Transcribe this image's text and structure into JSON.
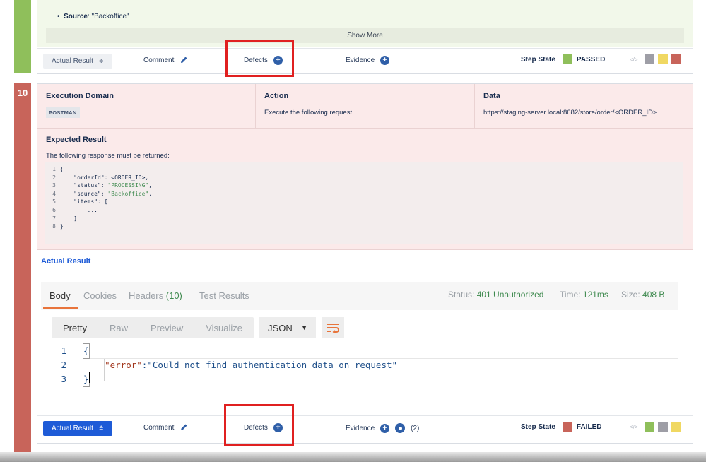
{
  "step9": {
    "source_label": "Source",
    "source_value": ": \"Backoffice\"",
    "show_more": "Show More",
    "toolbar": {
      "actual_result": "Actual Result",
      "actual_result_chevron": "≡",
      "comment": "Comment",
      "defects": "Defects",
      "evidence": "Evidence",
      "step_state_label": "Step State",
      "step_state_value": "PASSED",
      "state_color": "#8fbf5b",
      "status_squares": [
        "#9e9ea6",
        "#f0d862",
        "#c8645a"
      ]
    }
  },
  "step10": {
    "number": "10",
    "columns": {
      "execution_domain_header": "Execution Domain",
      "execution_domain_value": "POSTMAN",
      "action_header": "Action",
      "action_value": "Execute the following request.",
      "data_header": "Data",
      "data_value": "https://staging-server.local:8682/store/order/<ORDER_ID>"
    },
    "expected_result": {
      "title": "Expected Result",
      "description": "The following response must be returned:",
      "code_lines": [
        {
          "n": "1",
          "text": "{"
        },
        {
          "n": "2",
          "text": "    \"orderId\": <ORDER_ID>,"
        },
        {
          "n": "3",
          "key": "    \"status\": ",
          "str": "\"PROCESSING\"",
          "end": ","
        },
        {
          "n": "4",
          "key": "    \"source\": ",
          "str": "\"Backoffice\"",
          "end": ","
        },
        {
          "n": "5",
          "text": "    \"items\": ["
        },
        {
          "n": "6",
          "text": "        ..."
        },
        {
          "n": "7",
          "text": "    ]"
        },
        {
          "n": "8",
          "text": "}"
        }
      ]
    },
    "actual_result_title": "Actual Result",
    "postman": {
      "tabs": {
        "body": "Body",
        "cookies": "Cookies",
        "headers": "Headers",
        "headers_count": "(10)",
        "test_results": "Test Results"
      },
      "status_label": "Status:",
      "status_value": "401 Unauthorized",
      "time_label": "Time:",
      "time_value": "121ms",
      "size_label": "Size:",
      "size_value": "408 B",
      "formats": [
        "Pretty",
        "Raw",
        "Preview",
        "Visualize"
      ],
      "language": "JSON",
      "lines": [
        "1",
        "2",
        "3"
      ],
      "open_brace": "{",
      "close_brace": "}",
      "error_key": "\"error\"",
      "error_colon": ": ",
      "error_value": "\"Could not find authentication data on request\""
    },
    "toolbar": {
      "actual_result": "Actual Result",
      "actual_result_chevron": "⌃",
      "comment": "Comment",
      "defects": "Defects",
      "evidence": "Evidence",
      "evidence_count": "(2)",
      "step_state_label": "Step State",
      "step_state_value": "FAILED",
      "state_color": "#c8645a",
      "status_squares": [
        "#8fbf5b",
        "#9e9ea6",
        "#f0d862"
      ]
    }
  },
  "colors": {
    "accent_blue": "#1e5bd7",
    "highlight_red": "#e02020",
    "passed_green": "#8fbf5b",
    "failed_red": "#c8645a",
    "postman_orange": "#e8743b"
  }
}
